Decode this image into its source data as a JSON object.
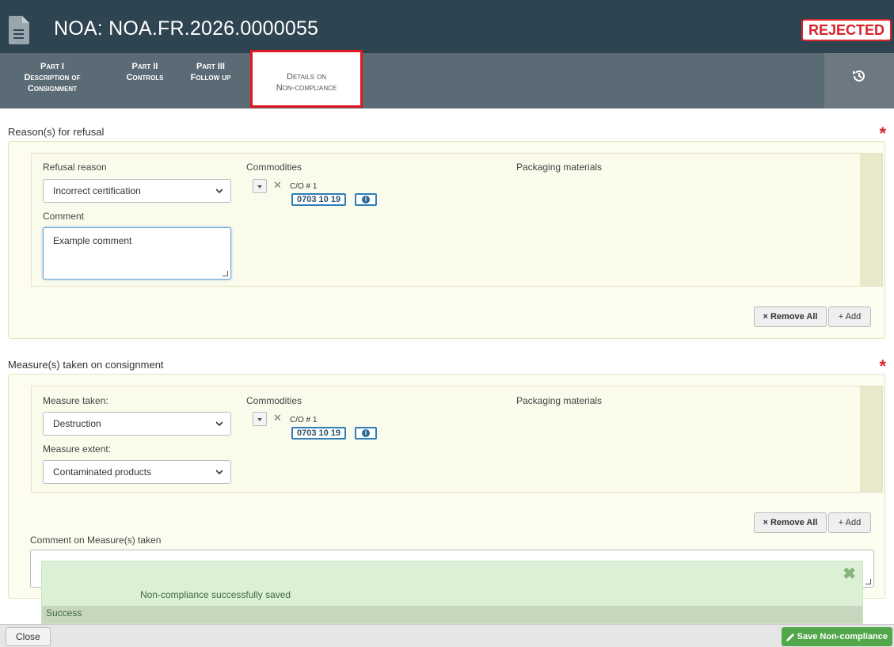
{
  "header": {
    "title": "NOA: NOA.FR.2026.0000055",
    "status": "REJECTED",
    "status_color": "#d9232d",
    "icon": "document-icon"
  },
  "tabs": [
    {
      "line1": "Part I",
      "line2": "Description of",
      "line3": "Consignment"
    },
    {
      "line1": "Part II",
      "line2": "Controls"
    },
    {
      "line1": "Part III",
      "line2": "Follow up"
    },
    {
      "line1": "Details on",
      "line2": "Non-compliance",
      "active": true
    }
  ],
  "history_icon": "history-icon",
  "refusal": {
    "section_title": "Reason(s) for refusal",
    "required_mark": "*",
    "refusal_reason_label": "Refusal reason",
    "refusal_reason_value": "Incorrect certification",
    "comment_label": "Comment",
    "comment_value": "Example comment",
    "commodities_label": "Commodities",
    "packaging_label": "Packaging materials",
    "co_label": "C/O # 1",
    "code": "0703 10 19",
    "remove_all": "× Remove All",
    "add": "+ Add"
  },
  "measures": {
    "section_title": "Measure(s) taken on consignment",
    "required_mark": "*",
    "measure_label": "Measure taken:",
    "measure_value": "Destruction",
    "extent_label": "Measure extent:",
    "extent_value": "Contaminated products",
    "commodities_label": "Commodities",
    "packaging_label": "Packaging materials",
    "co_label": "C/O # 1",
    "code": "0703 10 19",
    "remove_all": "× Remove All",
    "add": "+ Add",
    "comment_label": "Comment on Measure(s) taken"
  },
  "toast": {
    "message": "Non-compliance successfully saved",
    "title": "Success",
    "close": "✖"
  },
  "footer": {
    "close_label": "Close",
    "save_label": "Save Non-compliance",
    "save_color": "#52a74a"
  }
}
